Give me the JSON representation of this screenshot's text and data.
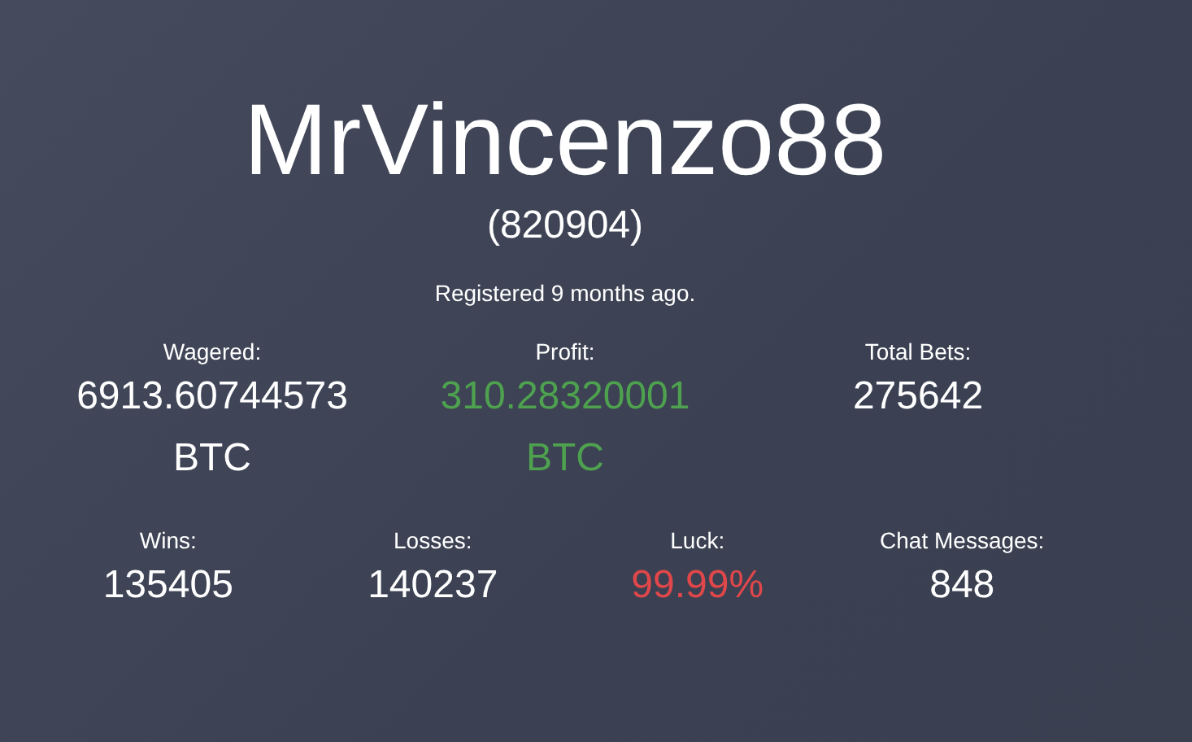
{
  "profile": {
    "username": "MrVincenzo88",
    "user_id": "(820904)",
    "registered": "Registered 9 months ago."
  },
  "stat_rows": [
    {
      "stats": [
        {
          "label": "Wagered:",
          "value": "6913.60744573 BTC",
          "kind": "plain"
        },
        {
          "label": "Profit:",
          "value": "310.28320001 BTC",
          "kind": "positive"
        },
        {
          "label": "Total Bets:",
          "value": "275642",
          "kind": "plain"
        }
      ]
    },
    {
      "stats": [
        {
          "label": "Wins:",
          "value": "135405",
          "kind": "plain"
        },
        {
          "label": "Losses:",
          "value": "140237",
          "kind": "plain"
        },
        {
          "label": "Luck:",
          "value": "99.99%",
          "kind": "negative"
        },
        {
          "label": "Chat Messages:",
          "value": "848",
          "kind": "plain"
        }
      ]
    }
  ]
}
